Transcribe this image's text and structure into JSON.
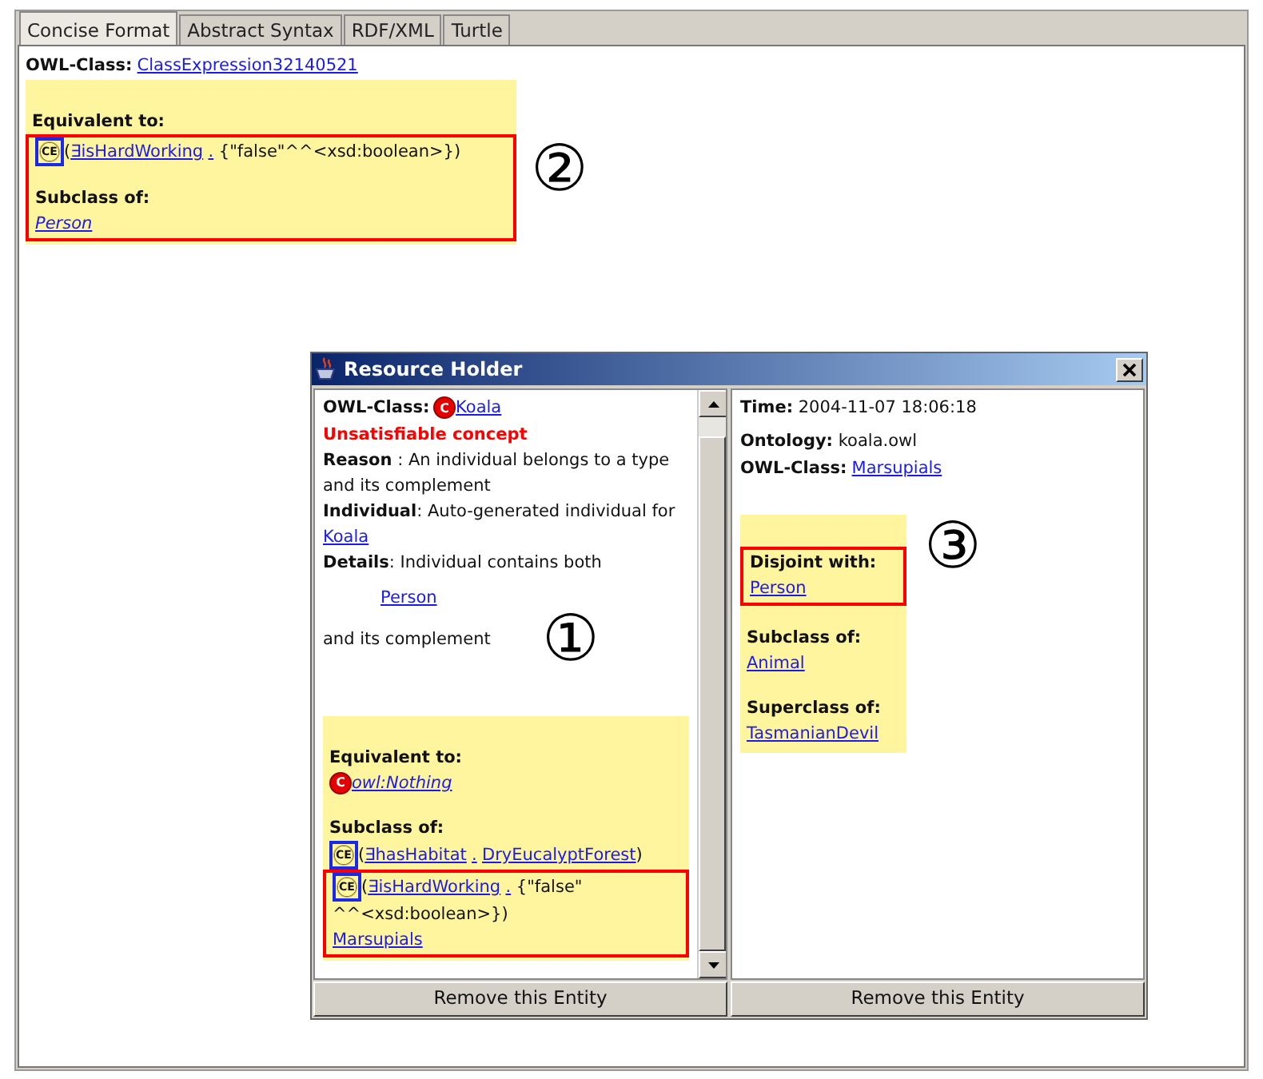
{
  "tabs": [
    {
      "label": "Concise Format",
      "selected": true
    },
    {
      "label": "Abstract Syntax",
      "selected": false
    },
    {
      "label": "RDF/XML",
      "selected": false
    },
    {
      "label": "Turtle",
      "selected": false
    }
  ],
  "main": {
    "lines": [
      {
        "kind": "field",
        "parts": [
          {
            "kind": "bold",
            "text": "OWL-Class:"
          },
          {
            "kind": "link",
            "text": "ClassExpression32140521"
          }
        ]
      }
    ],
    "panel": {
      "blocks": [
        {
          "framed": false,
          "lines": [
            {
              "kind": "heading",
              "parts": [
                {
                  "kind": "bold",
                  "text": "Equivalent to:"
                }
              ]
            }
          ]
        },
        {
          "framed": true,
          "lines": [
            {
              "kind": "expression",
              "parts": [
                {
                  "kind": "ce-icon",
                  "text": "CE"
                },
                {
                  "kind": "text",
                  "text": "("
                },
                {
                  "kind": "link",
                  "text": "∃isHardWorking"
                },
                {
                  "kind": "link",
                  "text": "."
                },
                {
                  "kind": "text",
                  "text": " {\"false\"^^<xsd:boolean>})"
                }
              ]
            },
            {
              "kind": "heading",
              "parts": [
                {
                  "kind": "bold",
                  "text": "Subclass of:"
                }
              ]
            },
            {
              "kind": "link",
              "parts": [
                {
                  "kind": "italic-link",
                  "text": "Person"
                }
              ]
            }
          ]
        }
      ]
    },
    "callout": "②"
  },
  "dialog": {
    "title": "Resource Holder",
    "left": {
      "lines": [
        {
          "kind": "field",
          "parts": [
            {
              "kind": "bold",
              "text": "OWL-Class:"
            },
            {
              "kind": "class-icon",
              "text": "C"
            },
            {
              "kind": "link",
              "text": "Koala"
            }
          ]
        },
        {
          "kind": "error",
          "parts": [
            {
              "kind": "red",
              "text": "Unsatisfiable concept"
            }
          ]
        },
        {
          "kind": "para",
          "parts": [
            {
              "kind": "bold",
              "text": "Reason"
            },
            {
              "kind": "text",
              "text": " : An individual belongs to a type and its complement"
            }
          ]
        },
        {
          "kind": "para",
          "parts": [
            {
              "kind": "bold",
              "text": "Individual"
            },
            {
              "kind": "text",
              "text": ": Auto-generated individual for "
            },
            {
              "kind": "link",
              "text": "Koala"
            }
          ]
        },
        {
          "kind": "para",
          "parts": [
            {
              "kind": "bold",
              "text": "Details"
            },
            {
              "kind": "text",
              "text": ": Individual contains both"
            }
          ]
        },
        {
          "kind": "indent",
          "parts": [
            {
              "kind": "link",
              "text": "Person"
            }
          ]
        },
        {
          "kind": "para",
          "parts": [
            {
              "kind": "text",
              "text": "and its complement"
            }
          ]
        }
      ],
      "panel": {
        "blocks": [
          {
            "framed": false,
            "lines": [
              {
                "kind": "heading",
                "parts": [
                  {
                    "kind": "bold",
                    "text": "Equivalent to:"
                  }
                ]
              },
              {
                "kind": "link",
                "parts": [
                  {
                    "kind": "class-icon",
                    "text": "C"
                  },
                  {
                    "kind": "italic-link",
                    "text": "owl:Nothing"
                  }
                ]
              },
              {
                "kind": "heading",
                "parts": [
                  {
                    "kind": "bold",
                    "text": "Subclass of:"
                  }
                ]
              },
              {
                "kind": "expression",
                "parts": [
                  {
                    "kind": "ce-icon",
                    "text": "CE"
                  },
                  {
                    "kind": "text",
                    "text": "("
                  },
                  {
                    "kind": "link",
                    "text": "∃hasHabitat"
                  },
                  {
                    "kind": "link",
                    "text": "."
                  },
                  {
                    "kind": "link",
                    "text": "DryEucalyptForest"
                  },
                  {
                    "kind": "text",
                    "text": ")"
                  }
                ]
              }
            ]
          },
          {
            "framed": true,
            "lines": [
              {
                "kind": "expression",
                "parts": [
                  {
                    "kind": "ce-icon",
                    "text": "CE"
                  },
                  {
                    "kind": "text",
                    "text": "("
                  },
                  {
                    "kind": "link",
                    "text": "∃isHardWorking"
                  },
                  {
                    "kind": "link",
                    "text": "."
                  },
                  {
                    "kind": "text",
                    "text": " {\"false\" ^^<xsd:boolean>})"
                  }
                ]
              },
              {
                "kind": "link",
                "parts": [
                  {
                    "kind": "link",
                    "text": "Marsupials"
                  }
                ]
              }
            ]
          }
        ]
      },
      "callout": "①",
      "button": "Remove this Entity"
    },
    "right": {
      "lines": [
        {
          "kind": "field",
          "parts": [
            {
              "kind": "bold",
              "text": "Time:"
            },
            {
              "kind": "text",
              "text": " 2004-11-07 18:06:18"
            }
          ]
        },
        {
          "kind": "field",
          "parts": [
            {
              "kind": "bold",
              "text": "Ontology:"
            },
            {
              "kind": "text",
              "text": " koala.owl"
            }
          ]
        },
        {
          "kind": "field",
          "parts": [
            {
              "kind": "bold",
              "text": "OWL-Class:"
            },
            {
              "kind": "link",
              "text": "Marsupials"
            }
          ]
        }
      ],
      "panel": {
        "blocks": [
          {
            "framed": true,
            "lines": [
              {
                "kind": "heading",
                "parts": [
                  {
                    "kind": "bold",
                    "text": "Disjoint with:"
                  }
                ]
              },
              {
                "kind": "link",
                "parts": [
                  {
                    "kind": "link",
                    "text": "Person"
                  }
                ]
              }
            ]
          },
          {
            "framed": false,
            "lines": [
              {
                "kind": "heading",
                "parts": [
                  {
                    "kind": "bold",
                    "text": "Subclass of:"
                  }
                ]
              },
              {
                "kind": "link",
                "parts": [
                  {
                    "kind": "link",
                    "text": "Animal"
                  }
                ]
              },
              {
                "kind": "heading",
                "parts": [
                  {
                    "kind": "bold",
                    "text": "Superclass of:"
                  }
                ]
              },
              {
                "kind": "link",
                "parts": [
                  {
                    "kind": "link",
                    "text": "TasmanianDevil"
                  }
                ]
              }
            ]
          }
        ]
      },
      "callout": "③",
      "button": "Remove this Entity"
    }
  }
}
